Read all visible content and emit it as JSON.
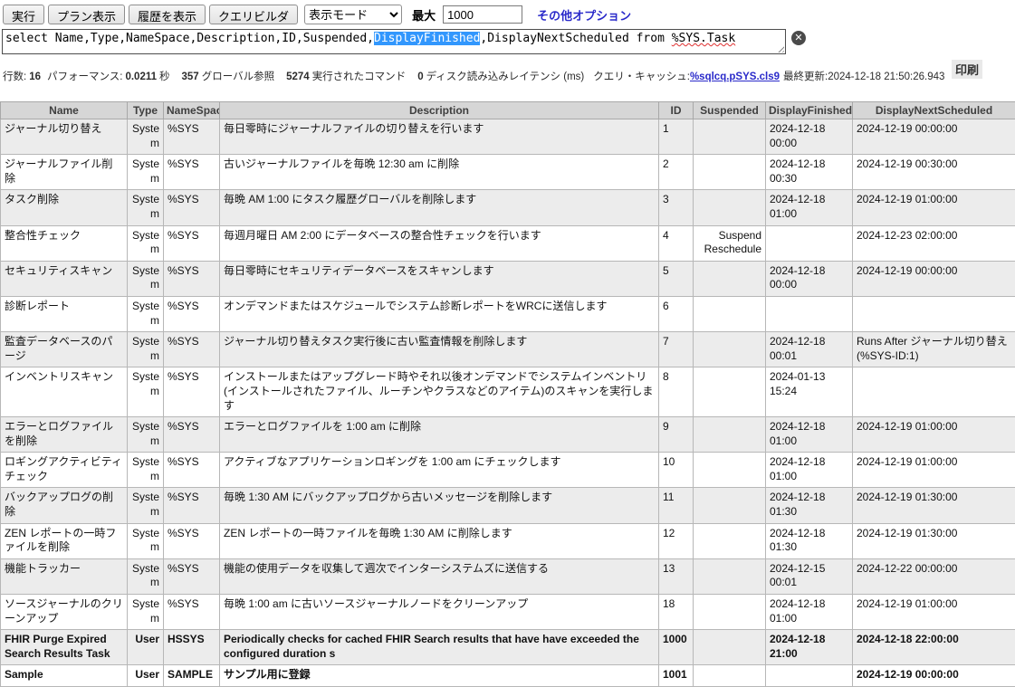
{
  "toolbar": {
    "execute": "実行",
    "show_plan": "プラン表示",
    "show_history": "履歴を表示",
    "query_builder": "クエリビルダ",
    "display_mode": "表示モード",
    "max_label": "最大",
    "max_value": "1000",
    "more_options": "その他オプション"
  },
  "query": {
    "before_selection": "select Name,Type,NameSpace,Description,ID,Suspended,",
    "selection": "DisplayFinished",
    "after_selection": ",DisplayNextScheduled from ",
    "misspelled": "%SYS.Task",
    "clear_icon": "✕"
  },
  "stats": {
    "segments": [
      {
        "label": "行数:",
        "value": "16"
      },
      {
        "label": "パフォーマンス:",
        "value": "0.0211",
        "suffix": "秒"
      },
      {
        "value": "357",
        "suffix": "グローバル参照"
      },
      {
        "value": "5274",
        "suffix": "実行されたコマンド"
      },
      {
        "value": "0",
        "suffix": "ディスク読み込みレイテンシ (ms)"
      },
      {
        "label": "クエリ・キャッシュ:",
        "link": "%sqlcq.pSYS.cls9"
      },
      {
        "label": "最終更新:2024-12-18 21:50:26.943"
      }
    ],
    "print_label": "印刷"
  },
  "table": {
    "columns": [
      "Name",
      "Type",
      "NameSpace",
      "Description",
      "ID",
      "Suspended",
      "DisplayFinished",
      "DisplayNextScheduled"
    ],
    "rows": [
      {
        "name": "ジャーナル切り替え",
        "type": "System",
        "namespace": "%SYS",
        "description": "毎日零時にジャーナルファイルの切り替えを行います",
        "id": "1",
        "suspended": "",
        "finished": "2024-12-18 00:00",
        "next": "2024-12-19 00:00:00"
      },
      {
        "name": "ジャーナルファイル削除",
        "type": "System",
        "namespace": "%SYS",
        "description": "古いジャーナルファイルを毎晩 12:30 am に削除",
        "id": "2",
        "suspended": "",
        "finished": "2024-12-18 00:30",
        "next": "2024-12-19 00:30:00"
      },
      {
        "name": "タスク削除",
        "type": "System",
        "namespace": "%SYS",
        "description": "毎晩 AM 1:00 にタスク履歴グローバルを削除します",
        "id": "3",
        "suspended": "",
        "finished": "2024-12-18 01:00",
        "next": "2024-12-19 01:00:00"
      },
      {
        "name": "整合性チェック",
        "type": "System",
        "namespace": "%SYS",
        "description": "毎週月曜日 AM 2:00 にデータベースの整合性チェックを行います",
        "id": "4",
        "suspended": "Suspend Reschedule",
        "finished": "",
        "next": "2024-12-23 02:00:00"
      },
      {
        "name": "セキュリティスキャン",
        "type": "System",
        "namespace": "%SYS",
        "description": "毎日零時にセキュリティデータベースをスキャンします",
        "id": "5",
        "suspended": "",
        "finished": "2024-12-18 00:00",
        "next": "2024-12-19 00:00:00"
      },
      {
        "name": "診断レポート",
        "type": "System",
        "namespace": "%SYS",
        "description": "オンデマンドまたはスケジュールでシステム診断レポートをWRCに送信します",
        "id": "6",
        "suspended": "",
        "finished": "",
        "next": ""
      },
      {
        "name": "監査データベースのパージ",
        "type": "System",
        "namespace": "%SYS",
        "description": "ジャーナル切り替えタスク実行後に古い監査情報を削除します",
        "id": "7",
        "suspended": "",
        "finished": "2024-12-18 00:01",
        "next": "Runs After ジャーナル切り替え (%SYS-ID:1)"
      },
      {
        "name": "インベントリスキャン",
        "type": "System",
        "namespace": "%SYS",
        "description": "インストールまたはアップグレード時やそれ以後オンデマンドでシステムインベントリ(インストールされたファイル、ルーチンやクラスなどのアイテム)のスキャンを実行します",
        "id": "8",
        "suspended": "",
        "finished": "2024-01-13 15:24",
        "next": ""
      },
      {
        "name": "エラーとログファイルを削除",
        "type": "System",
        "namespace": "%SYS",
        "description": "エラーとログファイルを 1:00 am に削除",
        "id": "9",
        "suspended": "",
        "finished": "2024-12-18 01:00",
        "next": "2024-12-19 01:00:00"
      },
      {
        "name": "ロギングアクティビティチェック",
        "type": "System",
        "namespace": "%SYS",
        "description": "アクティブなアプリケーションロギングを 1:00 am にチェックします",
        "id": "10",
        "suspended": "",
        "finished": "2024-12-18 01:00",
        "next": "2024-12-19 01:00:00"
      },
      {
        "name": "バックアップログの削除",
        "type": "System",
        "namespace": "%SYS",
        "description": "毎晩 1:30 AM にバックアップログから古いメッセージを削除します",
        "id": "11",
        "suspended": "",
        "finished": "2024-12-18 01:30",
        "next": "2024-12-19 01:30:00"
      },
      {
        "name": "ZEN レポートの一時ファイルを削除",
        "type": "System",
        "namespace": "%SYS",
        "description": "ZEN レポートの一時ファイルを毎晩 1:30 AM に削除します",
        "id": "12",
        "suspended": "",
        "finished": "2024-12-18 01:30",
        "next": "2024-12-19 01:30:00"
      },
      {
        "name": "機能トラッカー",
        "type": "System",
        "namespace": "%SYS",
        "description": "機能の使用データを収集して週次でインターシステムズに送信する",
        "id": "13",
        "suspended": "",
        "finished": "2024-12-15 00:01",
        "next": "2024-12-22 00:00:00"
      },
      {
        "name": "ソースジャーナルのクリーンアップ",
        "type": "System",
        "namespace": "%SYS",
        "description": "毎晩 1:00 am に古いソースジャーナルノードをクリーンアップ",
        "id": "18",
        "suspended": "",
        "finished": "2024-12-18 01:00",
        "next": "2024-12-19 01:00:00"
      },
      {
        "name": "FHIR Purge Expired Search Results Task",
        "type": "User",
        "namespace": "HSSYS",
        "description": "Periodically checks for cached FHIR Search results that have have exceeded the configured duration s",
        "id": "1000",
        "suspended": "",
        "finished": "2024-12-18 21:00",
        "next": "2024-12-18 22:00:00"
      },
      {
        "name": "Sample",
        "type": "User",
        "namespace": "SAMPLE",
        "description": "サンプル用に登録",
        "id": "1001",
        "suspended": "",
        "finished": "",
        "next": "2024-12-19 00:00:00"
      }
    ]
  }
}
